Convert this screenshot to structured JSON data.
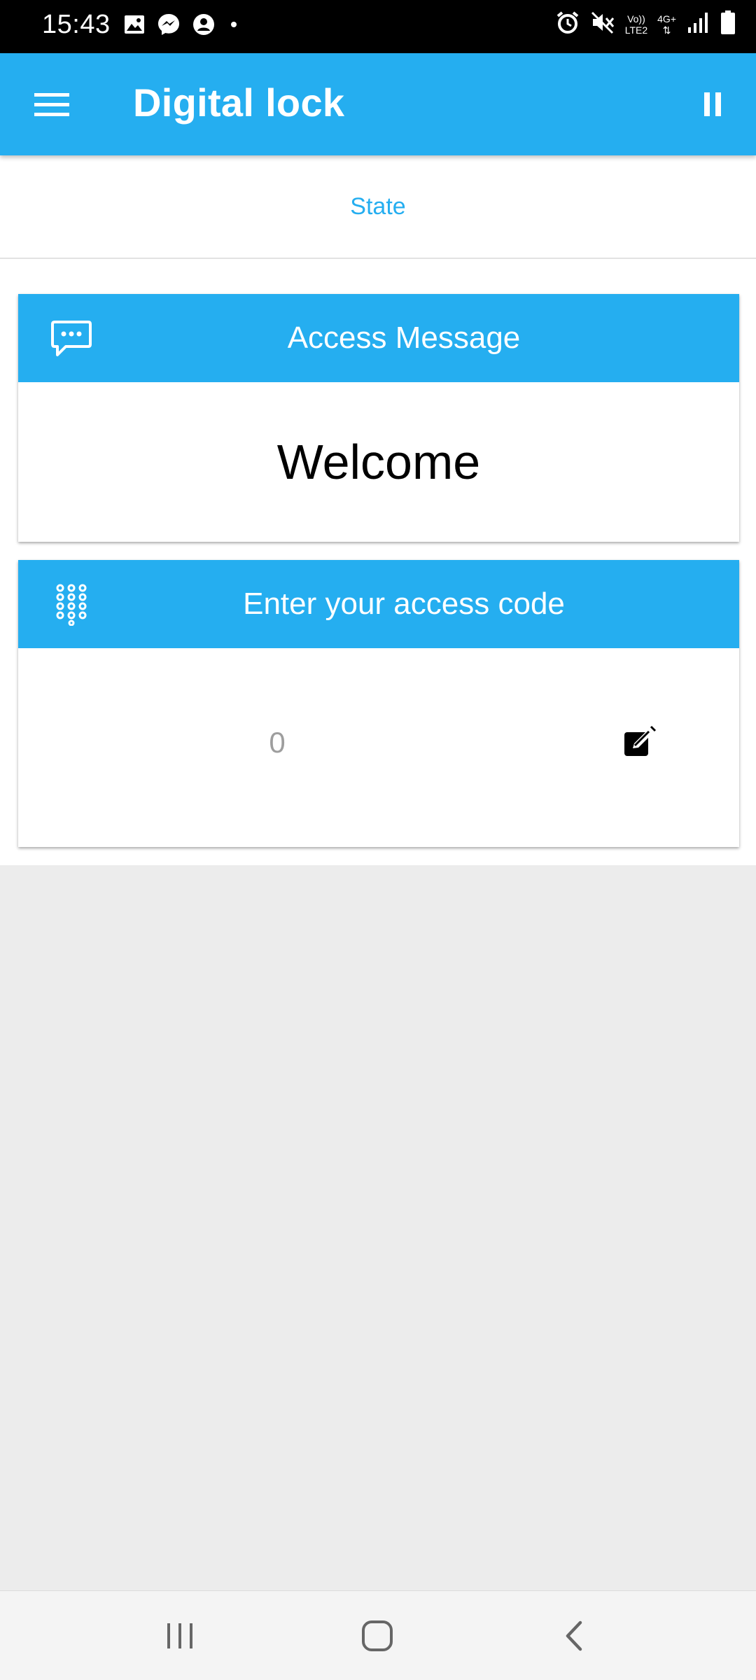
{
  "status_bar": {
    "time": "15:43",
    "left_icons": [
      "gallery-icon",
      "messenger-icon",
      "account-icon",
      "dot-icon"
    ],
    "right_icons": [
      "alarm-icon",
      "mute-icon",
      "volte-icon",
      "4g-icon",
      "signal-icon",
      "battery-icon"
    ],
    "volte_top": "Vo))",
    "volte_bottom": "LTE2",
    "network_type": "4G+"
  },
  "app_bar": {
    "title": "Digital lock",
    "menu_icon": "hamburger-menu-icon",
    "pause_icon": "pause-icon",
    "background_color": "#25aef0"
  },
  "tabs": {
    "state_label": "State",
    "accent_color": "#25aef0"
  },
  "access_message_card": {
    "title": "Access Message",
    "icon": "chat-bubble-icon",
    "message": "Welcome"
  },
  "access_code_card": {
    "title": "Enter your access code",
    "icon": "dialpad-icon",
    "input_placeholder": "0",
    "input_value": "",
    "edit_icon": "edit-icon"
  },
  "nav_bar": {
    "items": [
      "recent-apps-icon",
      "home-icon",
      "back-icon"
    ]
  }
}
